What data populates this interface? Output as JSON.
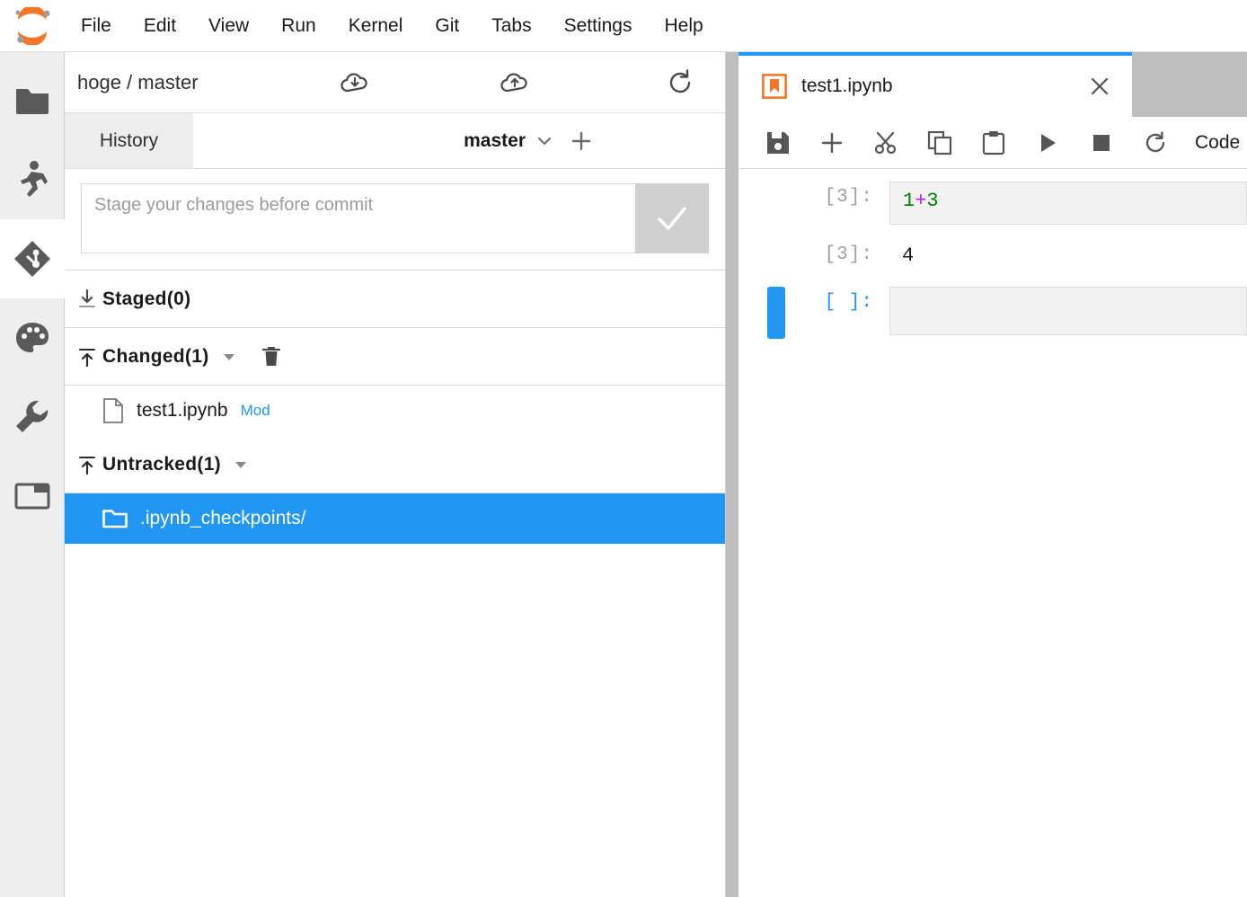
{
  "app": {
    "logo_name": "jupyterlab-logo",
    "accent_blue": "#2196f3",
    "logo_orange": "#f37726",
    "selected_row_blue": "#2196f3",
    "tabbar_gray": "#bdbdbd"
  },
  "menubar": {
    "items": [
      {
        "label": "File"
      },
      {
        "label": "Edit"
      },
      {
        "label": "View"
      },
      {
        "label": "Run"
      },
      {
        "label": "Kernel"
      },
      {
        "label": "Git"
      },
      {
        "label": "Tabs"
      },
      {
        "label": "Settings"
      },
      {
        "label": "Help"
      }
    ]
  },
  "sidebar": {
    "items": [
      {
        "icon": "folder-icon",
        "name": "file-browser",
        "active": false
      },
      {
        "icon": "running-man-icon",
        "name": "running-terminals",
        "active": false
      },
      {
        "icon": "git-icon",
        "name": "git-panel",
        "active": true
      },
      {
        "icon": "palette-icon",
        "name": "extension-manager",
        "active": false
      },
      {
        "icon": "wrench-icon",
        "name": "property-inspector",
        "active": false
      },
      {
        "icon": "tab-outline-icon",
        "name": "open-tabs",
        "active": false
      }
    ]
  },
  "git_panel": {
    "repo_label": "hoge / master",
    "header_icons": [
      {
        "name": "pull-icon",
        "label": "Pull from remote"
      },
      {
        "name": "push-icon",
        "label": "Push to remote"
      },
      {
        "name": "refresh-icon",
        "label": "Refresh"
      }
    ],
    "tabs": [
      {
        "label": "History",
        "name": "tab-history",
        "active": false
      }
    ],
    "branch": {
      "name": "master",
      "caret_icon": "chevron-down-icon",
      "new_branch_icon": "plus-icon"
    },
    "commit": {
      "placeholder": "Stage your changes before commit",
      "value": "",
      "button_icon": "check-icon",
      "button_enabled": false
    },
    "sections": [
      {
        "title": "Staged(0)",
        "name": "section-staged",
        "icon": "unstage-all-icon",
        "has_caret": false,
        "has_trash": false,
        "files": []
      },
      {
        "title": "Changed(1)",
        "name": "section-changed",
        "icon": "stage-all-icon",
        "has_caret": true,
        "has_trash": true,
        "files": [
          {
            "name": "test1.ipynb",
            "status": "Mod",
            "icon": "file-icon",
            "selected": false
          }
        ]
      },
      {
        "title": "Untracked(1)",
        "name": "section-untracked",
        "icon": "stage-all-icon",
        "has_caret": true,
        "has_trash": false,
        "files": [
          {
            "name": ".ipynb_checkpoints/",
            "status": "",
            "icon": "folder-icon",
            "selected": true
          }
        ]
      }
    ]
  },
  "notebook": {
    "tab": {
      "title": "test1.ipynb",
      "icon": "notebook-icon",
      "close_icon": "close-icon",
      "active": true
    },
    "toolbar": {
      "buttons": [
        {
          "name": "save-button",
          "icon": "save-icon"
        },
        {
          "name": "insert-cell-button",
          "icon": "plus-icon"
        },
        {
          "name": "cut-button",
          "icon": "scissors-icon"
        },
        {
          "name": "copy-button",
          "icon": "copy-icon"
        },
        {
          "name": "paste-button",
          "icon": "paste-icon"
        },
        {
          "name": "run-button",
          "icon": "play-icon"
        },
        {
          "name": "stop-button",
          "icon": "stop-icon"
        },
        {
          "name": "restart-button",
          "icon": "restart-icon"
        }
      ],
      "cell_type": "Code"
    },
    "cells": [
      {
        "kind": "input",
        "prompt": "[3]:",
        "prompt_blue": false,
        "tokens": [
          {
            "text": "1",
            "type": "num"
          },
          {
            "text": "+",
            "type": "op"
          },
          {
            "text": "3",
            "type": "num"
          }
        ],
        "selected": false
      },
      {
        "kind": "output",
        "prompt": "[3]:",
        "prompt_blue": false,
        "text": "4",
        "selected": false
      },
      {
        "kind": "input",
        "prompt": "[ ]:",
        "prompt_blue": true,
        "tokens": [],
        "selected": true
      }
    ]
  }
}
